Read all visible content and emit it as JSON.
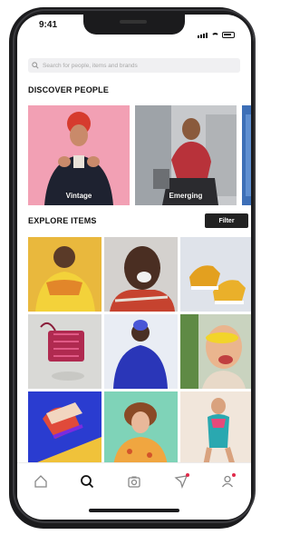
{
  "status": {
    "time": "9:41"
  },
  "search": {
    "placeholder": "Search for people, items and brands"
  },
  "discover": {
    "title": "DISCOVER PEOPLE",
    "people": [
      {
        "label": "Vintage",
        "bg": "#f2a0b4"
      },
      {
        "label": "Emerging",
        "bg": "#b9bcc0"
      },
      {
        "label": "",
        "bg": "#3d6fb7"
      }
    ]
  },
  "explore": {
    "title": "EXPLORE ITEMS",
    "filter_label": "Filter"
  },
  "tabs": [
    {
      "name": "home",
      "icon": "home-icon"
    },
    {
      "name": "search",
      "icon": "search-icon"
    },
    {
      "name": "sell",
      "icon": "camera-icon"
    },
    {
      "name": "activity",
      "icon": "send-icon"
    },
    {
      "name": "profile",
      "icon": "profile-icon"
    }
  ],
  "colors": {
    "accent": "#e02a4a",
    "button": "#222222"
  }
}
